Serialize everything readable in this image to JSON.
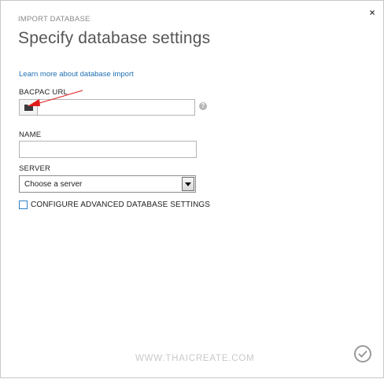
{
  "dialog": {
    "kicker": "IMPORT DATABASE",
    "title": "Specify database settings",
    "close_icon": "×"
  },
  "learn_more": {
    "label": "Learn more about database import"
  },
  "bacpac": {
    "label": "BACPAC URL",
    "value": "",
    "folder_icon": "folder-icon",
    "help_icon": "?"
  },
  "name": {
    "label": "NAME",
    "value": ""
  },
  "server": {
    "label": "SERVER",
    "selected": "Choose a server"
  },
  "advanced": {
    "label": "CONFIGURE ADVANCED DATABASE SETTINGS",
    "checked": false
  },
  "watermark": {
    "text": "WWW.THAICREATE.COM"
  },
  "footer": {
    "confirm_icon": "checkmark-icon"
  },
  "colors": {
    "link": "#1f6fb2",
    "annotation_arrow": "#e21a1a",
    "checkbox_border": "#2e7fc7"
  }
}
